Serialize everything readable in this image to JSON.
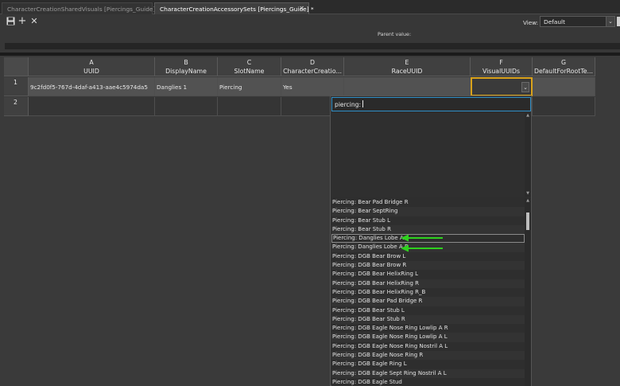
{
  "tabs": [
    {
      "label": "CharacterCreationSharedVisuals [Piercings_Guide]"
    },
    {
      "label": "CharacterCreationAccessorySets [Piercings_Guide] *"
    }
  ],
  "toolbar": {
    "icons": [
      "save-icon",
      "add-icon",
      "delete-icon"
    ],
    "view_label": "View:",
    "view_value": "Default",
    "parent_label": "Parent value:"
  },
  "columns": [
    {
      "letter": "A",
      "name": "UUID"
    },
    {
      "letter": "B",
      "name": "DisplayName"
    },
    {
      "letter": "C",
      "name": "SlotName"
    },
    {
      "letter": "D",
      "name": "CharacterCreatio..."
    },
    {
      "letter": "E",
      "name": "RaceUUID"
    },
    {
      "letter": "F",
      "name": "VisualUUIDs"
    },
    {
      "letter": "G",
      "name": "DefaultForRootTe..."
    }
  ],
  "rows": [
    {
      "num": "1",
      "cells": [
        "9c2fd0f5-767d-4daf-a413-aae4c5974da5",
        "Danglies 1",
        "Piercing",
        "Yes",
        "",
        "",
        ""
      ]
    },
    {
      "num": "2",
      "cells": [
        "",
        "",
        "",
        "",
        "",
        "",
        ""
      ]
    }
  ],
  "dropdown": {
    "search_value": "piercing:",
    "items": [
      "Piercing: Bear Pad Bridge R",
      "Piercing: Bear SeptRing",
      "Piercing: Bear Stub L",
      "Piercing: Bear Stub R",
      "Piercing: Danglies Lobe A L",
      "Piercing: Danglies Lobe A R",
      "Piercing: DGB Bear Brow L",
      "Piercing: DGB Bear Brow R",
      "Piercing: DGB Bear HelixRing L",
      "Piercing: DGB Bear HelixRing R",
      "Piercing: DGB Bear HelixRing R_B",
      "Piercing: DGB Bear Pad Bridge R",
      "Piercing: DGB Bear Stub L",
      "Piercing: DGB Bear Stub R",
      "Piercing: DGB Eagle Nose Ring Lowlip A R",
      "Piercing: DGB Eagle Nose Ring Lowlip A L",
      "Piercing: DGB Eagle Nose Ring Nostril A L",
      "Piercing: DGB Eagle Nose Ring R",
      "Piercing: DGB Eagle Ring L",
      "Piercing: DGB Eagle Sept Ring Nostril A L",
      "Piercing: DGB Eagle Stud"
    ],
    "highlighted_index": 4,
    "marked_indices": [
      4,
      5
    ]
  },
  "colors": {
    "selection_border": "#d9a21b",
    "search_border": "#2f8fc7",
    "annotation_arrow": "#2fd11f"
  }
}
